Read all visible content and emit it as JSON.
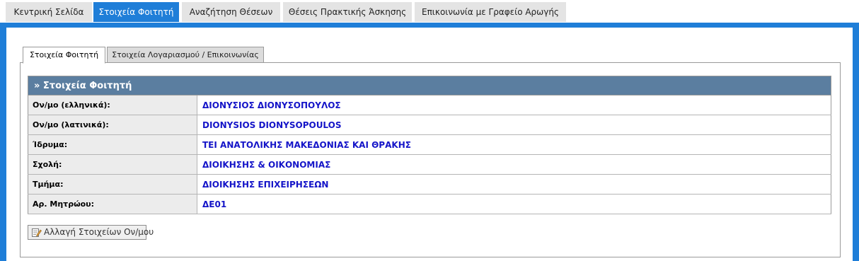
{
  "nav": {
    "tabs": [
      {
        "label": "Κεντρική Σελίδα",
        "active": false
      },
      {
        "label": "Στοιχεία Φοιτητή",
        "active": true
      },
      {
        "label": "Αναζήτηση Θέσεων",
        "active": false
      },
      {
        "label": "Θέσεις Πρακτικής Άσκησης",
        "active": false
      },
      {
        "label": "Επικοινωνία με Γραφείο Αρωγής",
        "active": false
      }
    ]
  },
  "subtabs": [
    {
      "label": "Στοιχεία Φοιτητή",
      "active": true
    },
    {
      "label": "Στοιχεία Λογαριασμού / Επικοινωνίας",
      "active": false
    }
  ],
  "student_table": {
    "title": "» Στοιχεία Φοιτητή",
    "rows": [
      {
        "label": "Ον/μο (ελληνικά):",
        "value": "ΔΙΟΝΥΣΙΟΣ ΔΙΟΝΥΣΟΠΟΥΛΟΣ"
      },
      {
        "label": "Ον/μο (λατινικά):",
        "value": "DIONYSIOS DIONYSOPOULOS"
      },
      {
        "label": "Ίδρυμα:",
        "value": "ΤΕΙ ΑΝΑΤΟΛΙΚΗΣ ΜΑΚΕΔΟΝΙΑΣ ΚΑΙ ΘΡΑΚΗΣ"
      },
      {
        "label": "Σχολή:",
        "value": "ΔΙΟΙΚΗΣΗΣ & ΟΙΚΟΝΟΜΙΑΣ"
      },
      {
        "label": "Τμήμα:",
        "value": "ΔΙΟΙΚΗΣΗΣ ΕΠΙΧΕΙΡΗΣΕΩΝ"
      },
      {
        "label": "Αρ. Μητρώου:",
        "value": "ΔΕ01"
      }
    ]
  },
  "edit_button": {
    "label": "Αλλαγή Στοιχείων Ον/μου",
    "icon": "edit-document-icon"
  },
  "colors": {
    "accent": "#1f7ed8",
    "table_header": "#5b7ea0",
    "value_text": "#1414c8"
  }
}
